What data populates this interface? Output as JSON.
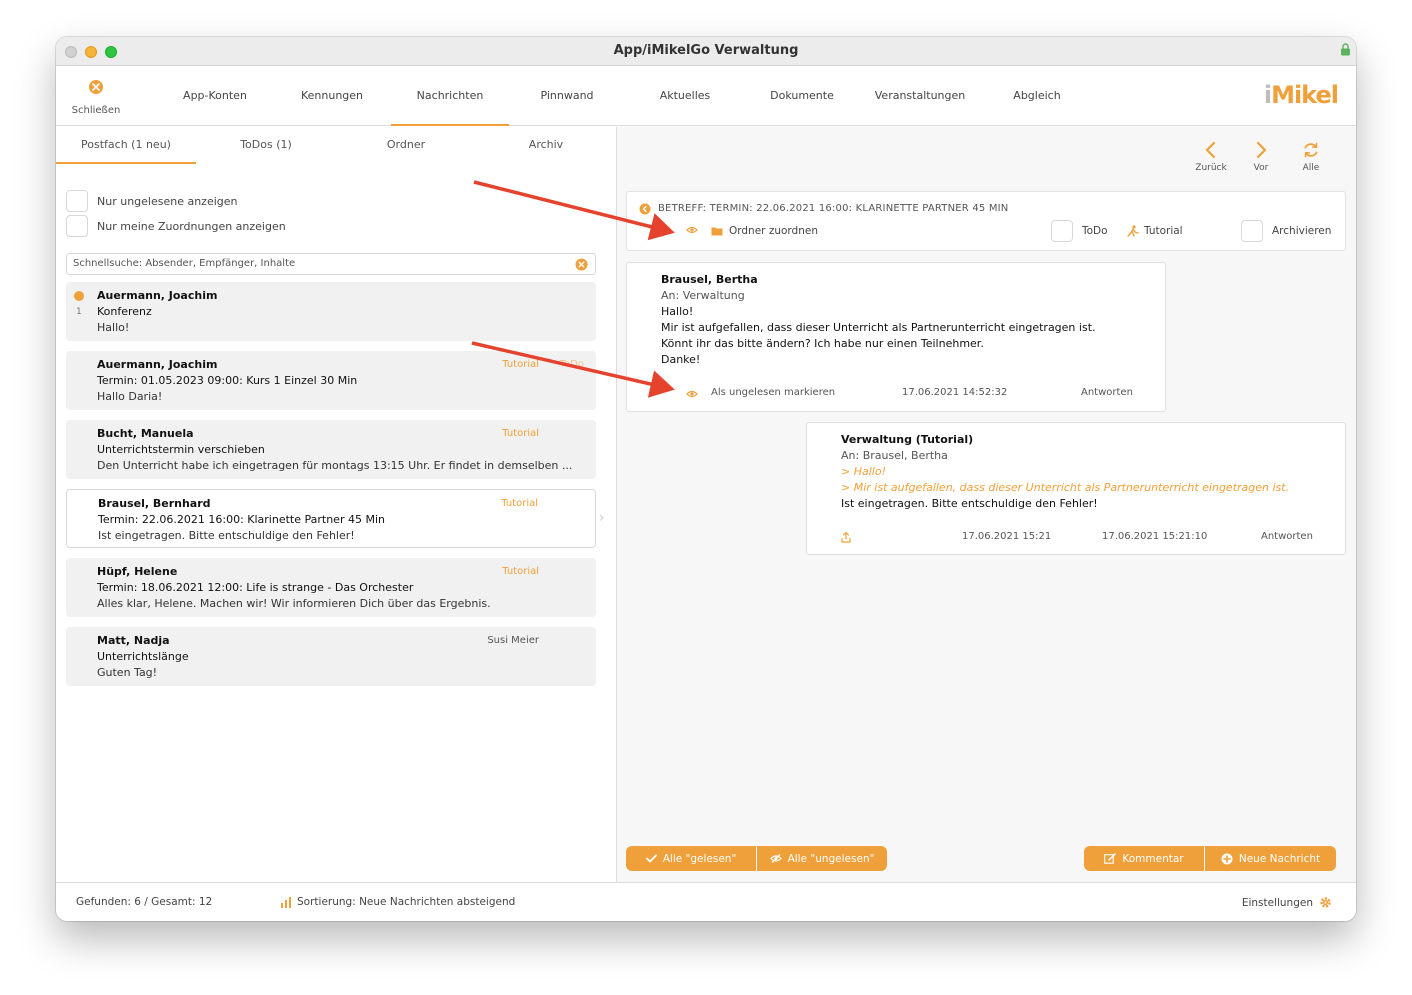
{
  "window": {
    "title": "App/iMikelGo Verwaltung"
  },
  "toolbar": {
    "close_label": "Schließen",
    "tabs": [
      "App-Konten",
      "Kennungen",
      "Nachrichten",
      "Pinnwand",
      "Aktuelles",
      "Dokumente",
      "Veranstaltungen",
      "Abgleich"
    ],
    "active_tab": "Nachrichten",
    "logo_i": "i",
    "logo_rest": "Mikel"
  },
  "left": {
    "tabs": [
      "Postfach (1 neu)",
      "ToDos (1)",
      "Ordner",
      "Archiv"
    ],
    "filter_unread": "Nur ungelesene anzeigen",
    "filter_mine": "Nur meine Zuordnungen anzeigen",
    "search_placeholder": "Schnellsuche: Absender, Empfänger, Inhalte",
    "messages": [
      {
        "sender": "Auermann, Joachim",
        "subject": "Konferenz",
        "preview": "Hallo!",
        "tag": "",
        "tag2": "",
        "unread": true,
        "unread_count": "1"
      },
      {
        "sender": "Auermann, Joachim",
        "subject": "Termin: 01.05.2023 09:00: Kurs 1 Einzel 30 Min",
        "preview": "Hallo Daria!",
        "tag": "Tutorial",
        "tag2": "ToDo"
      },
      {
        "sender": "Bucht, Manuela",
        "subject": "Unterrichtstermin verschieben",
        "preview": "Den Unterricht habe ich eingetragen für montags 13:15 Uhr. Er findet in demselben ...",
        "tag": "Tutorial",
        "tag2": ""
      },
      {
        "sender": "Brausel, Bernhard",
        "subject": "Termin: 22.06.2021 16:00: Klarinette Partner 45 Min",
        "preview": "Ist eingetragen. Bitte entschuldige den Fehler!",
        "tag": "Tutorial",
        "tag2": "",
        "selected": true
      },
      {
        "sender": "Hüpf, Helene",
        "subject": "Termin: 18.06.2021 12:00: Life is strange - Das Orchester",
        "preview": "Alles klar, Helene. Machen wir! Wir informieren Dich über das Ergebnis.",
        "tag": "Tutorial",
        "tag2": ""
      },
      {
        "sender": "Matt, Nadja",
        "subject": "Unterrichtslänge",
        "preview": "Guten Tag!",
        "tag": "Susi Meier",
        "tag2": ""
      }
    ]
  },
  "right": {
    "nav": {
      "back": "Zurück",
      "forward": "Vor",
      "all": "Alle"
    },
    "subject": "BETREFF: TERMIN: 22.06.2021 16:00: KLARINETTE PARTNER 45 MIN",
    "assign_folder": "Ordner zuordnen",
    "todo": "ToDo",
    "tutorial": "Tutorial",
    "archive": "Archivieren",
    "msg1": {
      "sender": "Brausel, Bertha",
      "to": "An: Verwaltung",
      "lines": [
        "Hallo!",
        "Mir ist aufgefallen, dass dieser Unterricht als Partnerunterricht eingetragen ist.",
        "Könnt ihr das bitte ändern? Ich habe nur einen Teilnehmer.",
        "Danke!"
      ],
      "mark_unread": "Als ungelesen markieren",
      "timestamp": "17.06.2021 14:52:32",
      "reply": "Antworten"
    },
    "msg2": {
      "sender": "Verwaltung (Tutorial)",
      "to": "An: Brausel, Bertha",
      "quote1": "> Hallo!",
      "quote2": "> Mir ist aufgefallen, dass dieser Unterricht als Partnerunterricht eingetragen ist.",
      "body": "Ist eingetragen. Bitte entschuldige den Fehler!",
      "time1": "17.06.2021 15:21",
      "time2": "17.06.2021 15:21:10",
      "reply": "Antworten"
    },
    "buttons": {
      "all_read": "Alle \"gelesen\"",
      "all_unread": "Alle \"ungelesen\"",
      "comment": "Kommentar",
      "new_message": "Neue Nachricht"
    }
  },
  "status": {
    "found": "Gefunden: 6 / Gesamt: 12",
    "sort": "Sortierung: Neue Nachrichten absteigend",
    "settings": "Einstellungen"
  },
  "colors": {
    "accent": "#f0a03a",
    "arrow": "#e5432e"
  }
}
